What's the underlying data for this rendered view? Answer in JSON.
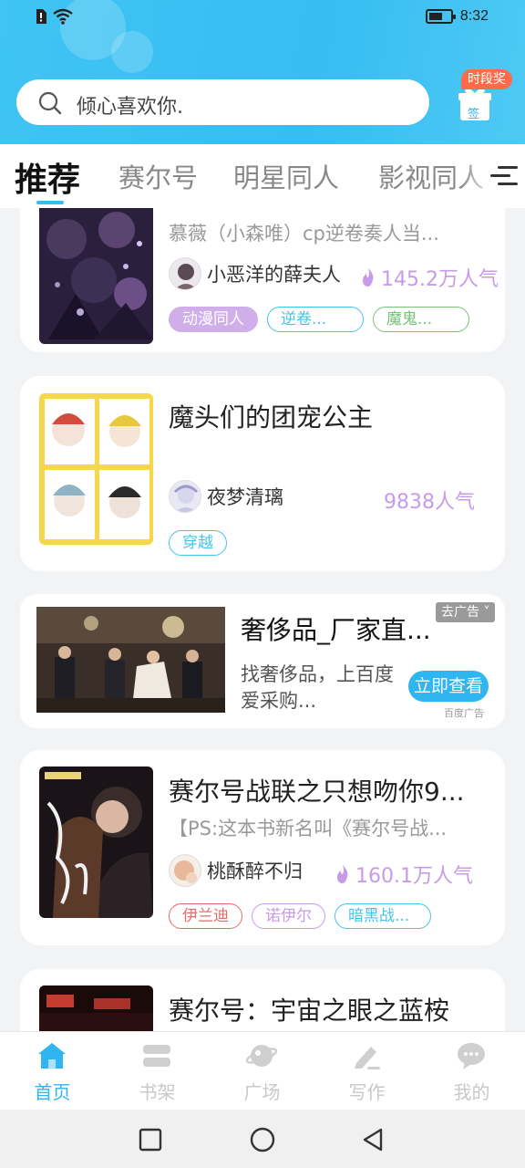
{
  "status_bar": {
    "time": "8:32"
  },
  "search": {
    "placeholder": "倾心喜欢你."
  },
  "gift": {
    "badge": "时段奖",
    "sign_label": "签"
  },
  "tabs": [
    {
      "label": "推荐",
      "active": true
    },
    {
      "label": "赛尔号",
      "active": false
    },
    {
      "label": "明星同人",
      "active": false
    },
    {
      "label": "影视同人",
      "active": false
    }
  ],
  "books": [
    {
      "title": "",
      "desc": "慕薇（小森唯）cp逆卷奏人当...",
      "author": "小恶洋的薛夫人",
      "popularity": "145.2万人气",
      "tags": [
        {
          "label": "动漫同人",
          "style": "filled-purple"
        },
        {
          "label": "逆卷...",
          "style": "outline-cyan"
        },
        {
          "label": "魔鬼...",
          "style": "outline-green"
        }
      ]
    },
    {
      "title": "魔头们的团宠公主",
      "desc": "",
      "author": "夜梦清璃",
      "popularity": "9838人气",
      "tags": [
        {
          "label": "穿越",
          "style": "outline-cyan"
        }
      ]
    },
    {
      "title": "赛尔号战联之只想吻你9...",
      "desc": "【PS:这本书新名叫《赛尔号战...",
      "author": "桃酥醉不归",
      "popularity": "160.1万人气",
      "tags": [
        {
          "label": "伊兰迪",
          "style": "outline-red"
        },
        {
          "label": "诺伊尔",
          "style": "outline-purple"
        },
        {
          "label": "暗黑战...",
          "style": "outline-cyan"
        }
      ]
    },
    {
      "title": "赛尔号：宇宙之眼之蓝桉",
      "desc": "",
      "author": "",
      "popularity": "",
      "tags": []
    }
  ],
  "ad": {
    "title": "奢侈品_厂家直...",
    "desc": "找奢侈品，上百度爱采购...",
    "close_label": "去广告 ˅",
    "cta": "立即查看",
    "source": "百度广告"
  },
  "nav": [
    {
      "label": "首页",
      "icon": "home-icon",
      "active": true
    },
    {
      "label": "书架",
      "icon": "bookshelf-icon",
      "active": false
    },
    {
      "label": "广场",
      "icon": "planet-icon",
      "active": false
    },
    {
      "label": "写作",
      "icon": "pencil-icon",
      "active": false
    },
    {
      "label": "我的",
      "icon": "chat-bubble-icon",
      "active": false
    }
  ],
  "colors": {
    "accent": "#2fb5f0",
    "popularity": "#c79be8",
    "header": "#3fc4f3"
  }
}
